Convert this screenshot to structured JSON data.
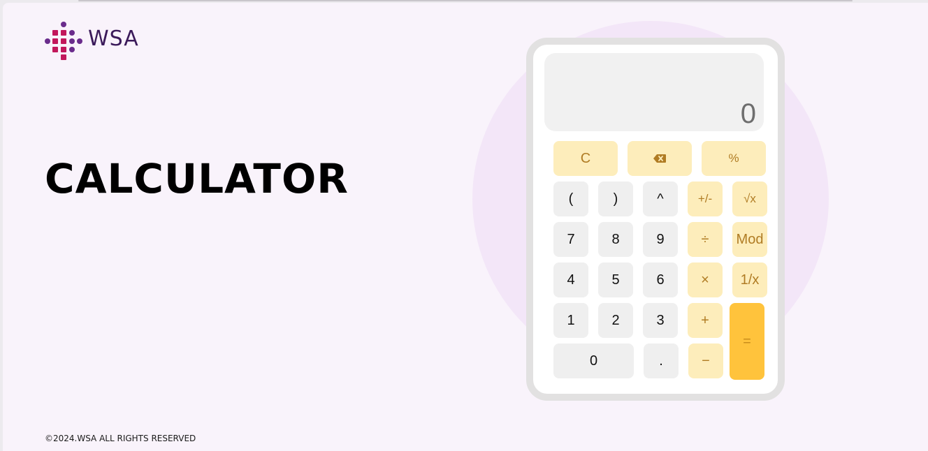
{
  "brand": {
    "logo_text": "WSA",
    "colors": {
      "magenta": "#c2185b",
      "purple": "#6a2c8c",
      "text": "#3b1a5a"
    }
  },
  "hero": {
    "title": "CALCULATOR"
  },
  "footer": {
    "copyright": "©2024.WSA ALL RIGHTS RESERVED"
  },
  "calculator": {
    "display_value": "0",
    "keys": {
      "clear": "C",
      "backspace_icon": "backspace-icon",
      "percent": "%",
      "open_paren": "(",
      "close_paren": ")",
      "power": "^",
      "negate": "+/-",
      "sqrt": "√x",
      "seven": "7",
      "eight": "8",
      "nine": "9",
      "divide": "÷",
      "mod": "Mod",
      "four": "4",
      "five": "5",
      "six": "6",
      "multiply": "×",
      "reciprocal": "1/x",
      "one": "1",
      "two": "2",
      "three": "3",
      "add": "+",
      "equals": "=",
      "zero": "0",
      "decimal": ".",
      "subtract": "−"
    },
    "colors": {
      "number_key": "#efefef",
      "operator_key": "#fdedbb",
      "operator_text": "#b07c24",
      "equals_key": "#ffc33c",
      "display_bg": "#f1f1f1",
      "frame": "#e2e1e1"
    }
  }
}
